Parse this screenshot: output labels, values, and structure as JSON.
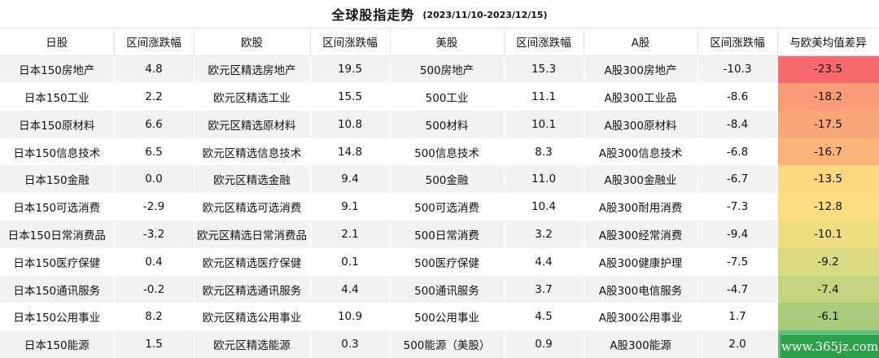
{
  "title": "全球股指走势",
  "subtitle": "(2023/11/10-2023/12/15)",
  "headers": [
    "日股",
    "区间涨跌幅",
    "欧股",
    "区间涨跌幅",
    "美股",
    "区间涨跌幅",
    "A股",
    "区间涨跌幅",
    "与欧美均值差异"
  ],
  "rows": [
    [
      "日本150房地产",
      "4.8",
      "欧元区精选房地产",
      "19.5",
      "500房地产",
      "15.3",
      "A股300房地产",
      "-10.3",
      "-23.5"
    ],
    [
      "日本150工业",
      "2.2",
      "欧元区精选工业",
      "15.5",
      "500工业",
      "11.1",
      "A股300工业品",
      "-8.6",
      "-18.2"
    ],
    [
      "日本150原材料",
      "6.6",
      "欧元区精选原材料",
      "10.8",
      "500材料",
      "10.1",
      "A股300原材料",
      "-8.4",
      "-17.5"
    ],
    [
      "日本150信息技术",
      "6.5",
      "欧元区精选信息技术",
      "14.8",
      "500信息技术",
      "8.3",
      "A股300信息技术",
      "-6.8",
      "-16.7"
    ],
    [
      "日本150金融",
      "0.0",
      "欧元区精选金融",
      "9.4",
      "500金融",
      "11.0",
      "A股300金融业",
      "-6.7",
      "-13.5"
    ],
    [
      "日本150可选消费",
      "-2.9",
      "欧元区精选可选消费",
      "9.1",
      "500可选消费",
      "10.4",
      "A股300耐用消费",
      "-7.3",
      "-12.8"
    ],
    [
      "日本150日常消费品",
      "-3.2",
      "欧元区精选日常消费品",
      "2.1",
      "500日常消费",
      "3.2",
      "A股300经常消费",
      "-9.4",
      "-10.1"
    ],
    [
      "日本150医疗保健",
      "0.4",
      "欧元区精选医疗保健",
      "0.1",
      "500医疗保健",
      "4.4",
      "A股300健康护理",
      "-7.5",
      "-9.2"
    ],
    [
      "日本150通讯服务",
      "-0.2",
      "欧元区精选通讯服务",
      "4.4",
      "500通讯服务",
      "3.7",
      "A股300电信服务",
      "-4.7",
      "-7.4"
    ],
    [
      "日本150公用事业",
      "8.2",
      "欧元区精选公用事业",
      "10.9",
      "500公用事业",
      "4.5",
      "A股300公用事业",
      "1.7",
      "-6.1"
    ],
    [
      "日本150能源",
      "1.5",
      "欧元区精选能源",
      "0.3",
      "500能源（美股）",
      "0.9",
      "A股300能源",
      "2.0",
      ""
    ]
  ],
  "diff_colors": [
    "#f8696b",
    "#f99b76",
    "#faa777",
    "#fbb379",
    "#fed880",
    "#fedd81",
    "#edde82",
    "#d9da80",
    "#c4d47e",
    "#a9cc7c",
    "#63be7b"
  ],
  "watermark": "www.365jz.com"
}
